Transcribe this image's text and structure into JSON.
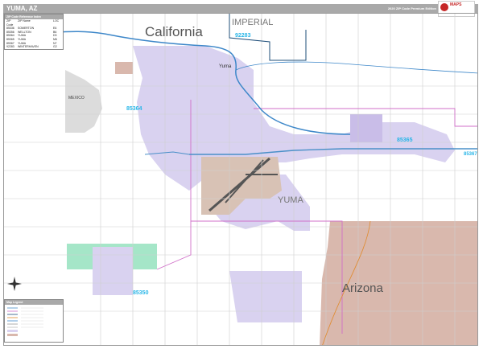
{
  "header": {
    "title": "YUMA, AZ",
    "edition": "2020 ZIP Code Premium Edition",
    "logo_text": "MAPS"
  },
  "zip_legend": {
    "title": "ZIP Code Reference Index",
    "columns": [
      "ZIP Code",
      "ZIP Name",
      "LOC"
    ],
    "rows": [
      [
        "85336",
        "SOMERTON",
        "E6"
      ],
      [
        "85356",
        "WELLTON",
        "B6"
      ],
      [
        "85364",
        "YUMA",
        "D3"
      ],
      [
        "85365",
        "YUMA",
        "M6"
      ],
      [
        "85367",
        "YUMA",
        "N7"
      ],
      [
        "92283",
        "WINTERHAVEN",
        "G2"
      ]
    ]
  },
  "legend_key": {
    "title": "Map Legend"
  },
  "map_labels": {
    "california": "California",
    "imperial": "IMPERIAL",
    "mexico": "MEXICO",
    "yuma_city": "Yuma",
    "yuma_county": "YUMA",
    "arizona": "Arizona",
    "zip_92283": "92283",
    "zip_85364": "85364",
    "zip_85365": "85365",
    "zip_85367": "85367",
    "zip_85350": "85350"
  },
  "colors": {
    "urban": "#d9d2f0",
    "urban_dense": "#c9bde8",
    "airport": "#d8c2b5",
    "arizona_land": "#d9b8ad",
    "green_zone": "#a5e6c8",
    "mexico_land": "#dcdcdc",
    "river": "#3d87c9",
    "zip_label": "#29b6e8",
    "county_line": "#d06fc8",
    "county_line_dark": "#1f4f7a",
    "highway": "#4a90c8"
  }
}
